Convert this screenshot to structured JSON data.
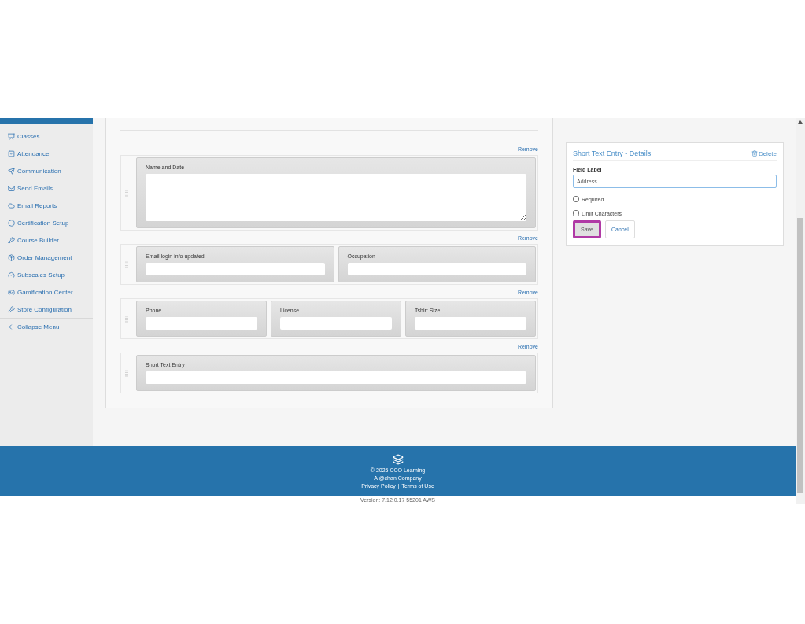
{
  "sidebar": {
    "items": [
      {
        "label": "Classes"
      },
      {
        "label": "Attendance"
      },
      {
        "label": "Communication"
      },
      {
        "label": "Send Emails"
      },
      {
        "label": "Email Reports"
      },
      {
        "label": "Certification Setup"
      },
      {
        "label": "Course Builder"
      },
      {
        "label": "Order Management"
      },
      {
        "label": "Subscales Setup"
      },
      {
        "label": "Gamification Center"
      },
      {
        "label": "Store Configuration"
      },
      {
        "label": "Collapse Menu",
        "kind": "toggle"
      }
    ]
  },
  "form": {
    "rows": [
      {
        "remove": "Remove",
        "fields": [
          {
            "label": "Name and Date",
            "kind": "textarea"
          }
        ]
      },
      {
        "remove": "Remove",
        "fields": [
          {
            "label": "Email login info updated",
            "kind": "text"
          },
          {
            "label": "Occupation",
            "kind": "text"
          }
        ]
      },
      {
        "remove": "Remove",
        "fields": [
          {
            "label": "Phone",
            "kind": "text"
          },
          {
            "label": "License",
            "kind": "text"
          },
          {
            "label": "Tshirt Size",
            "kind": "text"
          }
        ]
      },
      {
        "remove": "Remove",
        "fields": [
          {
            "label": "Short Text Entry",
            "kind": "text"
          }
        ]
      }
    ]
  },
  "details": {
    "title": "Short Text Entry - Details",
    "delete": "Delete",
    "field_label": "Field Label",
    "value": "Address",
    "checkboxes": [
      {
        "label": "Required",
        "checked": false
      },
      {
        "label": "Limit Characters",
        "checked": false
      }
    ],
    "buttons": [
      {
        "label": "Save",
        "kind": "primary",
        "highlighted": true
      },
      {
        "label": "Cancel",
        "kind": "secondary",
        "highlighted": false
      }
    ]
  },
  "footer": {
    "copyright": "© 2025 CCO Learning",
    "company": "A @chan Company",
    "links": [
      "Privacy Policy",
      "Terms of Use"
    ],
    "separator": "|",
    "version": "Version: 7.12.0.17 55201 AWS"
  }
}
